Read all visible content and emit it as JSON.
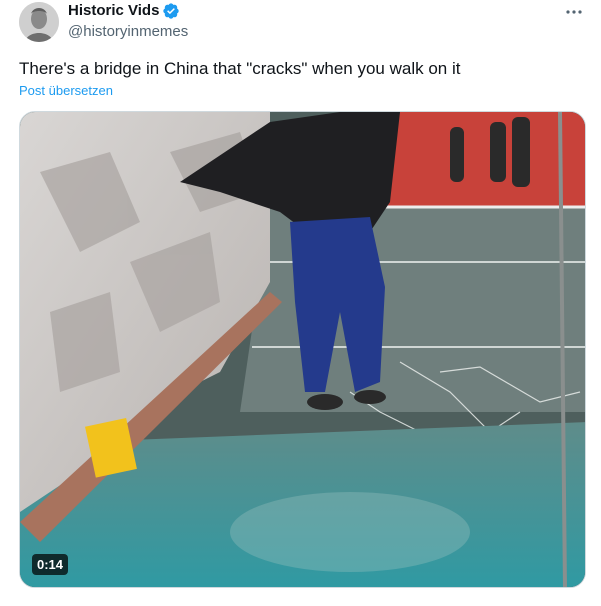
{
  "author": {
    "display_name": "Historic Vids",
    "handle": "@historyinmemes",
    "verified": true,
    "avatar_icon": "portrait-avatar"
  },
  "menu": {
    "icon": "more-horizontal-icon"
  },
  "tweet": {
    "text": "There's a bridge in China that \"cracks\" when you walk on it",
    "translate_label": "Post übersetzen"
  },
  "media": {
    "type": "video",
    "duration": "0:14"
  },
  "colors": {
    "text_primary": "#0f1419",
    "text_secondary": "#536471",
    "link": "#1d9bf0",
    "verified": "#1d9bf0"
  }
}
